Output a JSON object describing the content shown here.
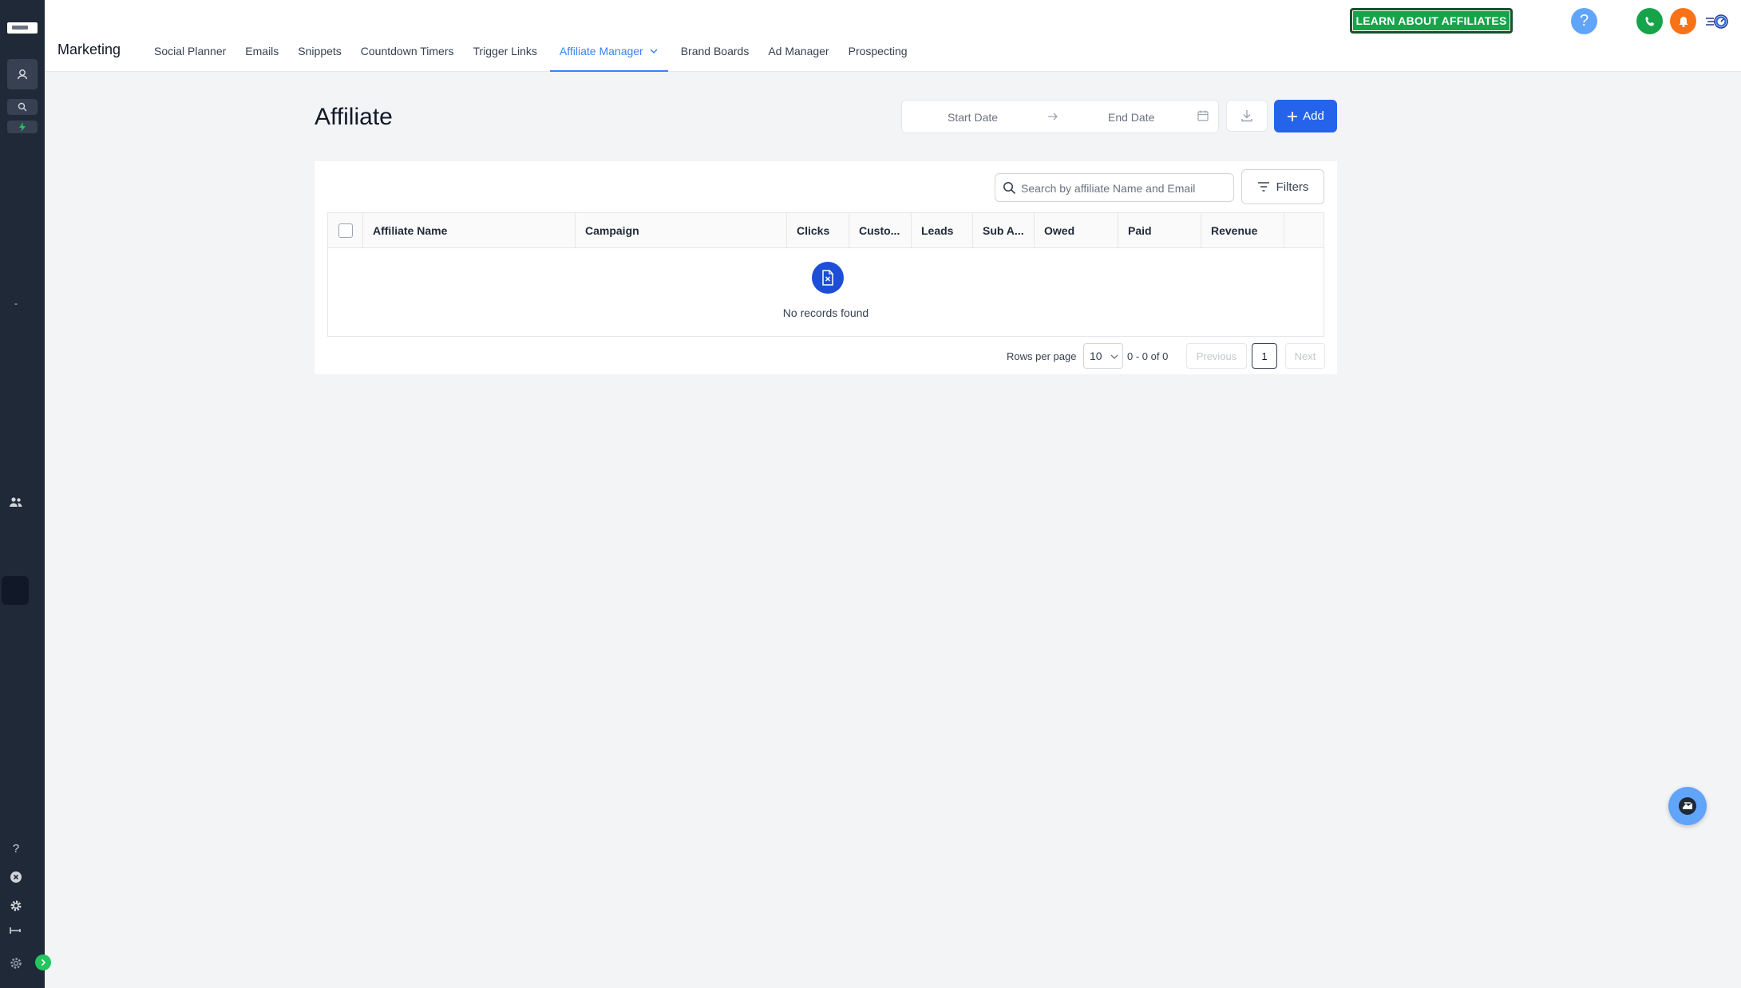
{
  "header": {
    "app_title": "Marketing",
    "tabs": [
      {
        "label": "Social Planner"
      },
      {
        "label": "Emails"
      },
      {
        "label": "Snippets"
      },
      {
        "label": "Countdown Timers"
      },
      {
        "label": "Trigger Links"
      },
      {
        "label": "Affiliate Manager",
        "active": true
      },
      {
        "label": "Brand Boards"
      },
      {
        "label": "Ad Manager"
      },
      {
        "label": "Prospecting"
      }
    ],
    "learn_button": "LEARN ABOUT AFFILIATES",
    "help_label": "?"
  },
  "page": {
    "title": "Affiliate",
    "start_date_placeholder": "Start Date",
    "end_date_placeholder": "End Date",
    "add_label": "Add"
  },
  "table": {
    "search_placeholder": "Search by affiliate Name and Email",
    "filters_label": "Filters",
    "columns": [
      "Affiliate Name",
      "Campaign",
      "Clicks",
      "Custo...",
      "Leads",
      "Sub A...",
      "Owed",
      "Paid",
      "Revenue"
    ],
    "empty_text": "No records found"
  },
  "pagination": {
    "rows_per_page_label": "Rows per page",
    "rows_per_page": "10",
    "range": "0 - 0 of 0",
    "previous": "Previous",
    "page": "1",
    "next": "Next"
  },
  "sidebar": {
    "dash": "-",
    "help_label": "?"
  },
  "colors": {
    "accent": "#2563eb",
    "learn_button": "#16a34a",
    "sidebar": "#1f2937",
    "notification": "#f97316",
    "phone": "#16a34a"
  }
}
